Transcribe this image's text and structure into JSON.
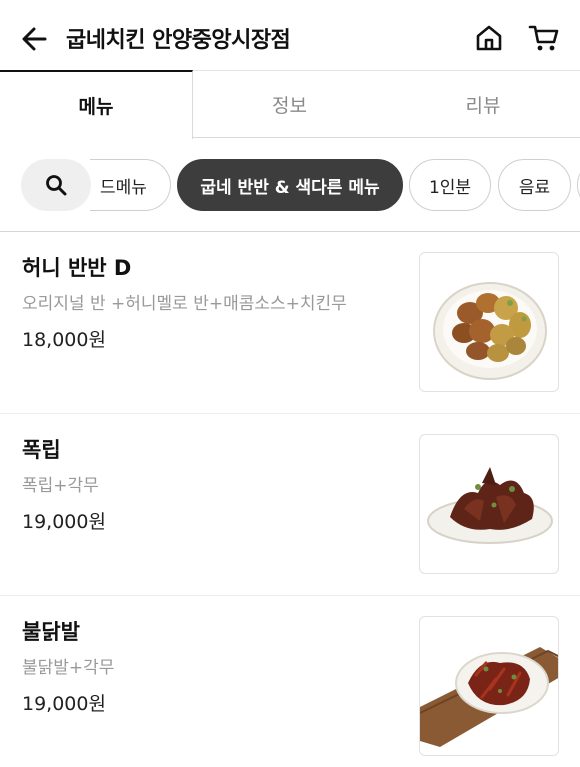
{
  "header": {
    "title": "굽네치킨 안양중앙시장점",
    "back_icon": "arrow-left-icon",
    "home_icon": "home-icon",
    "cart_icon": "cart-icon"
  },
  "tabs": [
    {
      "label": "메뉴",
      "active": true
    },
    {
      "label": "정보",
      "active": false
    },
    {
      "label": "리뷰",
      "active": false
    }
  ],
  "categories": {
    "search_icon": "search-icon",
    "items": [
      {
        "label": "드메뉴",
        "active": false
      },
      {
        "label": "굽네 반반 & 색다른 메뉴",
        "active": true
      },
      {
        "label": "1인분",
        "active": false
      },
      {
        "label": "음료",
        "active": false
      }
    ]
  },
  "menu": [
    {
      "name": "허니 반반 D",
      "desc": "오리지널 반 +허니멜로 반+매콤소스+치킨무",
      "price": "18,000원",
      "image": "fried-chicken-platter"
    },
    {
      "name": "폭립",
      "desc": "폭립+각무",
      "price": "19,000원",
      "image": "pork-ribs-plate"
    },
    {
      "name": "불닭발",
      "desc": "불닭발+각무",
      "price": "19,000원",
      "image": "spicy-chicken-feet-plate"
    }
  ],
  "colors": {
    "accent_dark": "#3d3d3d",
    "muted_text": "#999999"
  }
}
